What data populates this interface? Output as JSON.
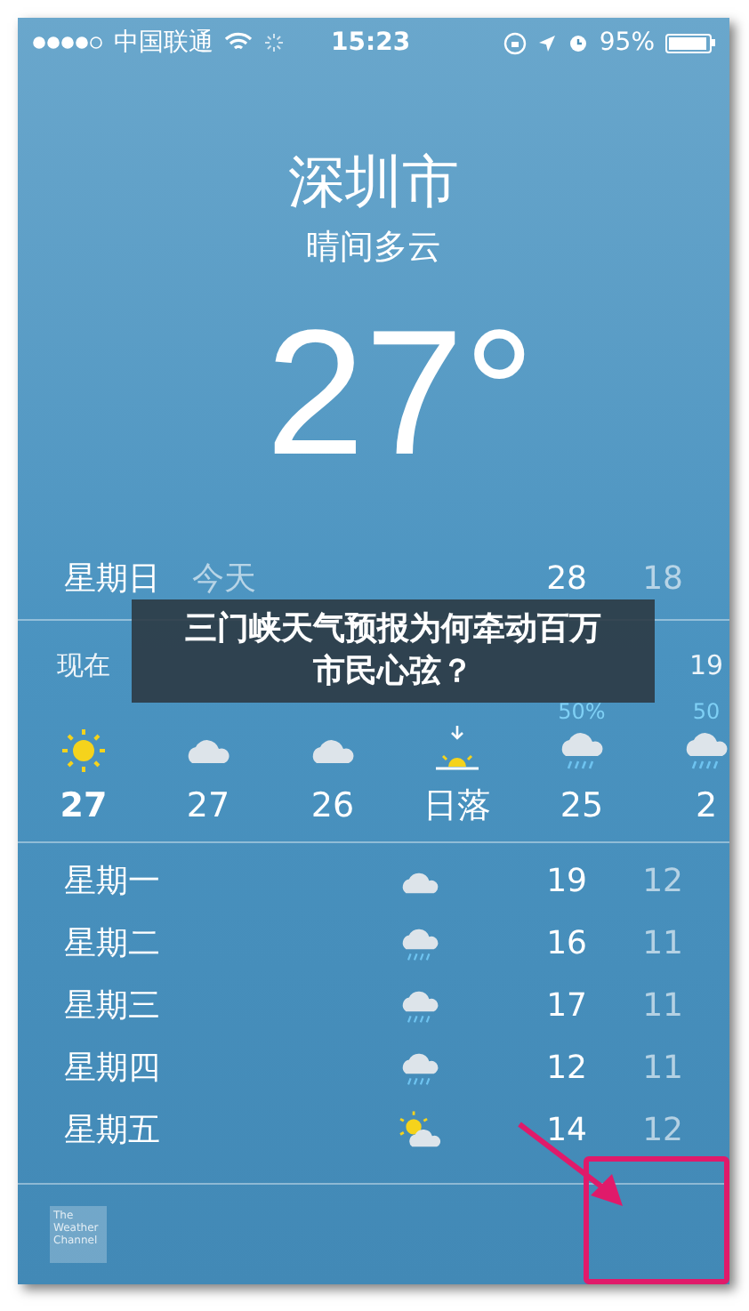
{
  "status_bar": {
    "carrier": "中国联通",
    "time": "15:23",
    "battery": "95%"
  },
  "location": {
    "city": "深圳市",
    "condition": "晴间多云",
    "temperature": "27°"
  },
  "today": {
    "day": "星期日",
    "label": "今天",
    "high": "28",
    "low": "18"
  },
  "hourly": [
    {
      "time": "现在",
      "kind": "sun",
      "value": "27",
      "bold": true
    },
    {
      "kind": "cloud",
      "value": "27",
      "bold": false
    },
    {
      "kind": "cloud",
      "value": "26",
      "bold": false
    },
    {
      "kind": "sunset",
      "value": "日落",
      "bold": false
    },
    {
      "chance": "50%",
      "kind": "rain",
      "value": "25",
      "bold": false
    },
    {
      "time": "19",
      "chance": "50",
      "kind": "rain",
      "value": "2",
      "bold": false
    }
  ],
  "daily": [
    {
      "day": "星期一",
      "kind": "cloud",
      "high": "19",
      "low": "12"
    },
    {
      "day": "星期二",
      "kind": "rain",
      "high": "16",
      "low": "11"
    },
    {
      "day": "星期三",
      "kind": "rain",
      "high": "17",
      "low": "11"
    },
    {
      "day": "星期四",
      "kind": "rain",
      "high": "12",
      "low": "11"
    },
    {
      "day": "星期五",
      "kind": "partly",
      "high": "14",
      "low": "12"
    }
  ],
  "footer": {
    "logo": "The Weather Channel"
  },
  "banner": {
    "title": "三门峡天气预报为何牵动百万市民心弦？"
  }
}
